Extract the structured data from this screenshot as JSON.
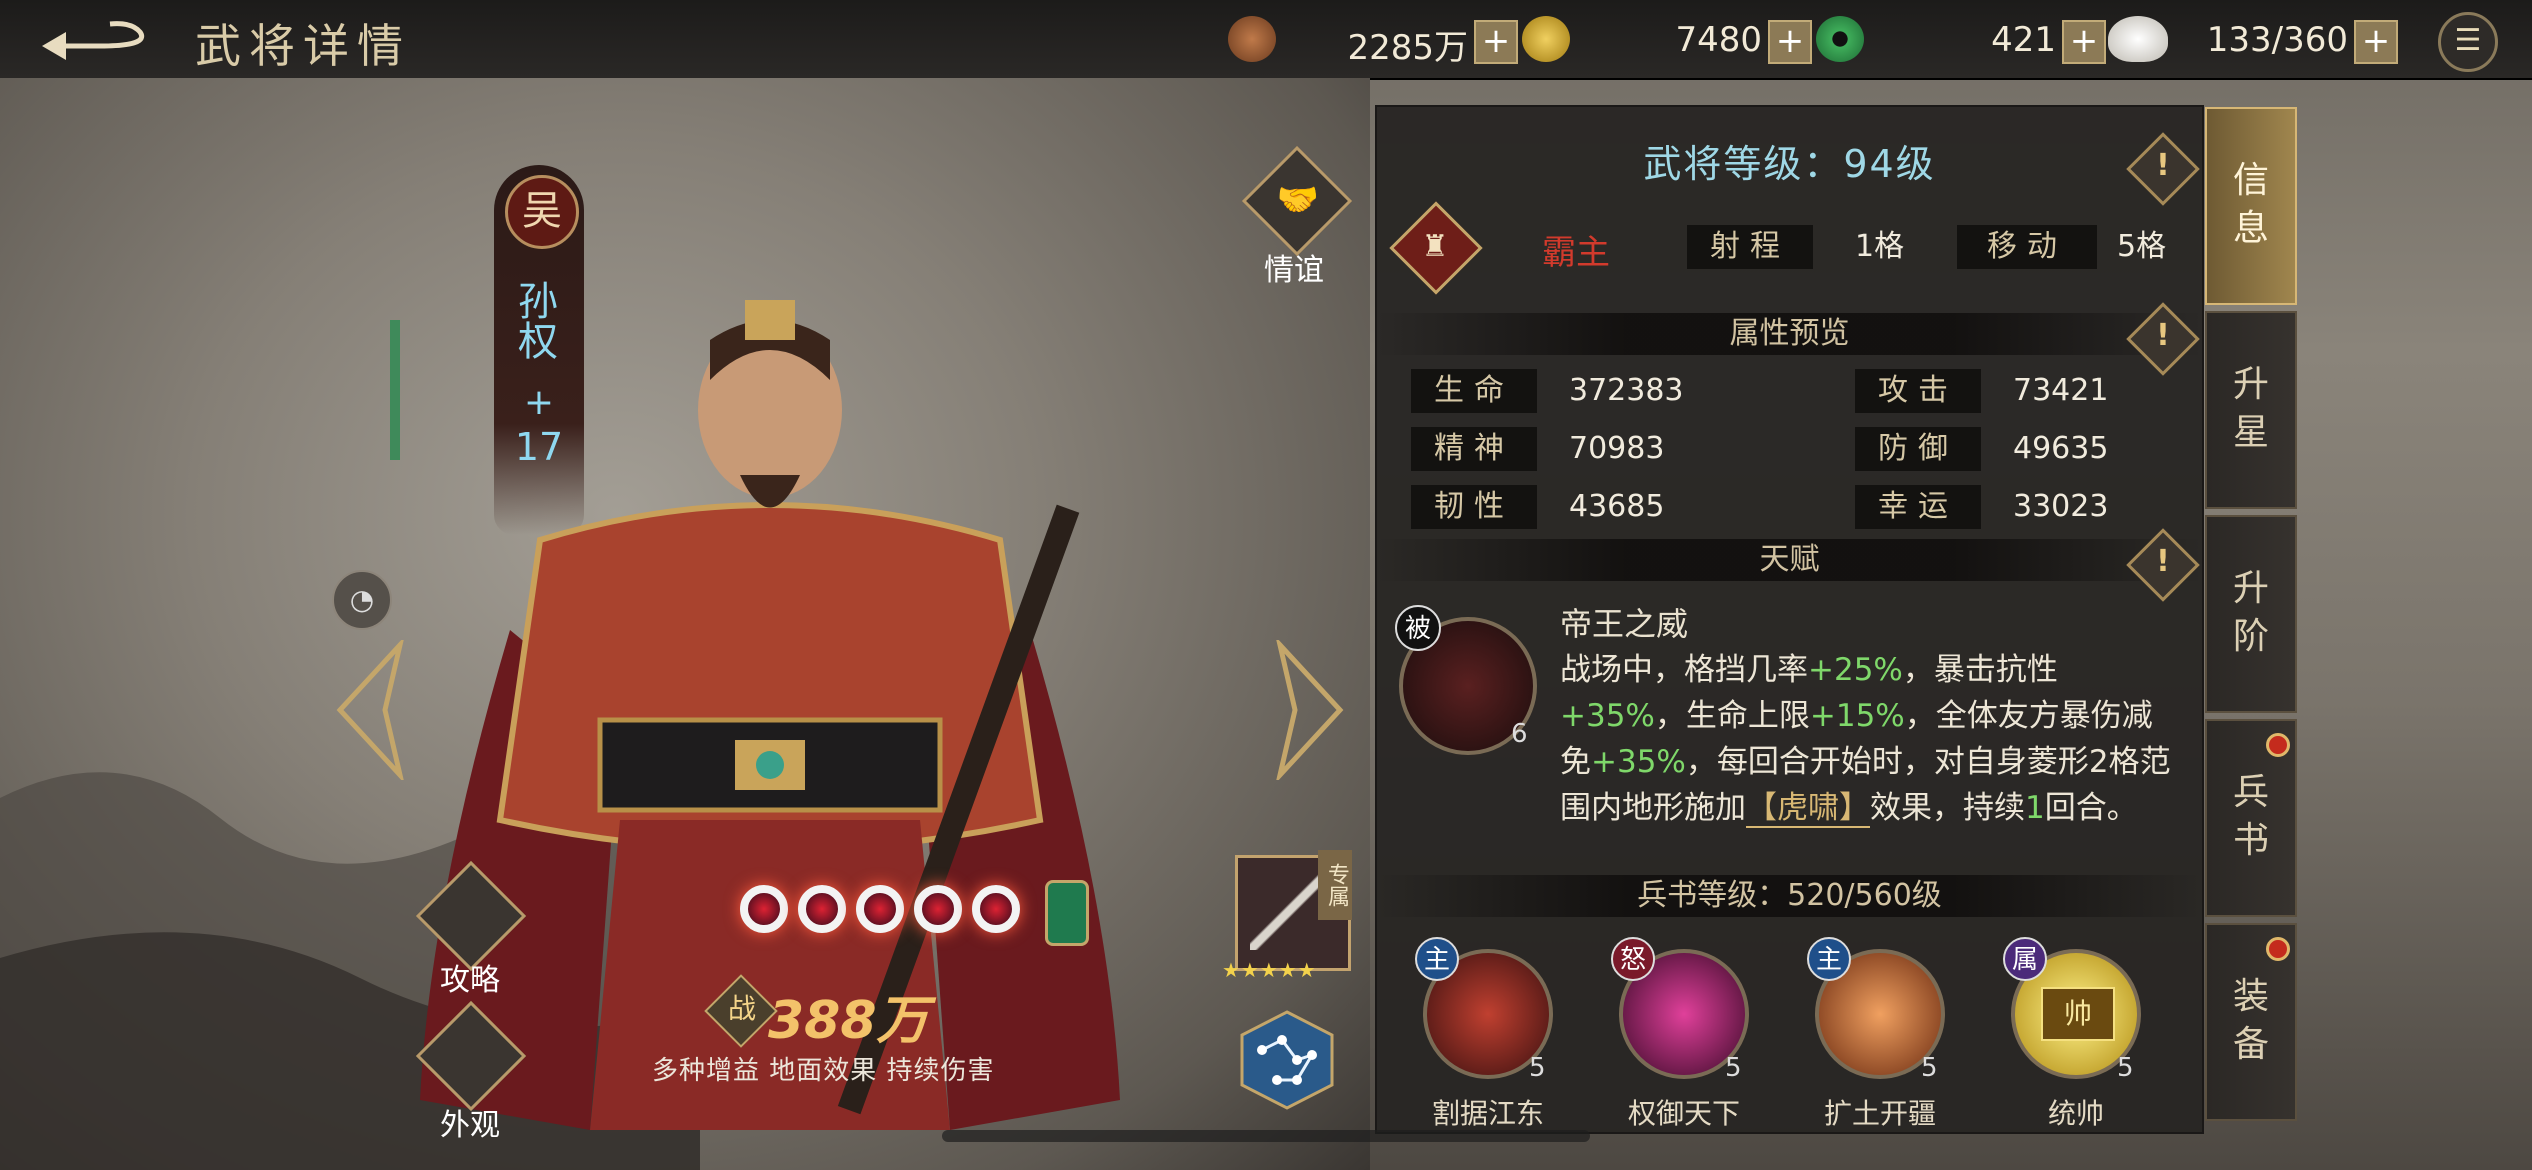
{
  "header": {
    "title": "武将详情"
  },
  "resources": [
    {
      "icon": "copper-coins-icon",
      "value": "2285万",
      "plus": "+"
    },
    {
      "icon": "gold-coin-icon",
      "value": "7480",
      "plus": "+"
    },
    {
      "icon": "jade-coin-icon",
      "value": "421",
      "plus": "+"
    },
    {
      "icon": "steamed-bun-icon",
      "value": "133/360",
      "plus": "+"
    }
  ],
  "hero": {
    "faction": "吴",
    "name": "孙权",
    "plus": "+",
    "plus_level": "17",
    "friendship_label": "情谊",
    "strategy_label": "攻略",
    "appearance_label": "外观",
    "power_badge": "战",
    "power": "388万",
    "effects": "多种增益 地面效果 持续伤害",
    "exclusive_label": "专属",
    "exclusive_stars": "★★★★★",
    "star_count": 5
  },
  "panel": {
    "level_text": "武将等级：94级",
    "class_name": "霸主",
    "range_label": "射程",
    "range_value": "1格",
    "move_label": "移动",
    "move_value": "5格",
    "attr_header": "属性预览",
    "stats": [
      {
        "label": "生命",
        "value": "372383"
      },
      {
        "label": "攻击",
        "value": "73421"
      },
      {
        "label": "精神",
        "value": "70983"
      },
      {
        "label": "防御",
        "value": "49635"
      },
      {
        "label": "韧性",
        "value": "43685"
      },
      {
        "label": "幸运",
        "value": "33023"
      }
    ],
    "talent_header": "天赋",
    "talent": {
      "badge": "被",
      "level": "6",
      "name": "帝王之威",
      "desc_1": "战场中，格挡几率",
      "v1": "+25%",
      "desc_2": "，暴击抗性",
      "v2": "+35%",
      "desc_3": "，生命上限",
      "v3": "+15%",
      "desc_4": "，全体友方暴伤减免",
      "v4": "+35%",
      "desc_5": "，每回合开始时，对自身菱形2格范围内地形施加",
      "keyword": "【虎啸】",
      "desc_6": "效果，持续",
      "v5": "1",
      "desc_7": "回合。"
    },
    "book_header": "兵书等级：520/560级",
    "skills": [
      {
        "badge": "主",
        "level": "5",
        "name": "割据江东",
        "color": "#1f4f8a"
      },
      {
        "badge": "怒",
        "level": "5",
        "name": "权御天下",
        "color": "#7a1a2a"
      },
      {
        "badge": "主",
        "level": "5",
        "name": "扩土开疆",
        "color": "#1f4f8a"
      },
      {
        "badge": "属",
        "level": "5",
        "name": "统帅",
        "color": "#4b2a7a"
      }
    ],
    "skill4_text": "帅"
  },
  "tabs": [
    {
      "label_1": "信",
      "label_2": "息",
      "active": true
    },
    {
      "label_1": "升",
      "label_2": "星"
    },
    {
      "label_1": "升",
      "label_2": "阶"
    },
    {
      "label_1": "兵",
      "label_2": "书"
    },
    {
      "label_1": "装",
      "label_2": "备"
    }
  ],
  "colors": {
    "accent_gold": "#c4a66a",
    "stat_green": "#7fd86a",
    "class_red": "#d23a2c",
    "name_cyan": "#8fd8f0"
  }
}
